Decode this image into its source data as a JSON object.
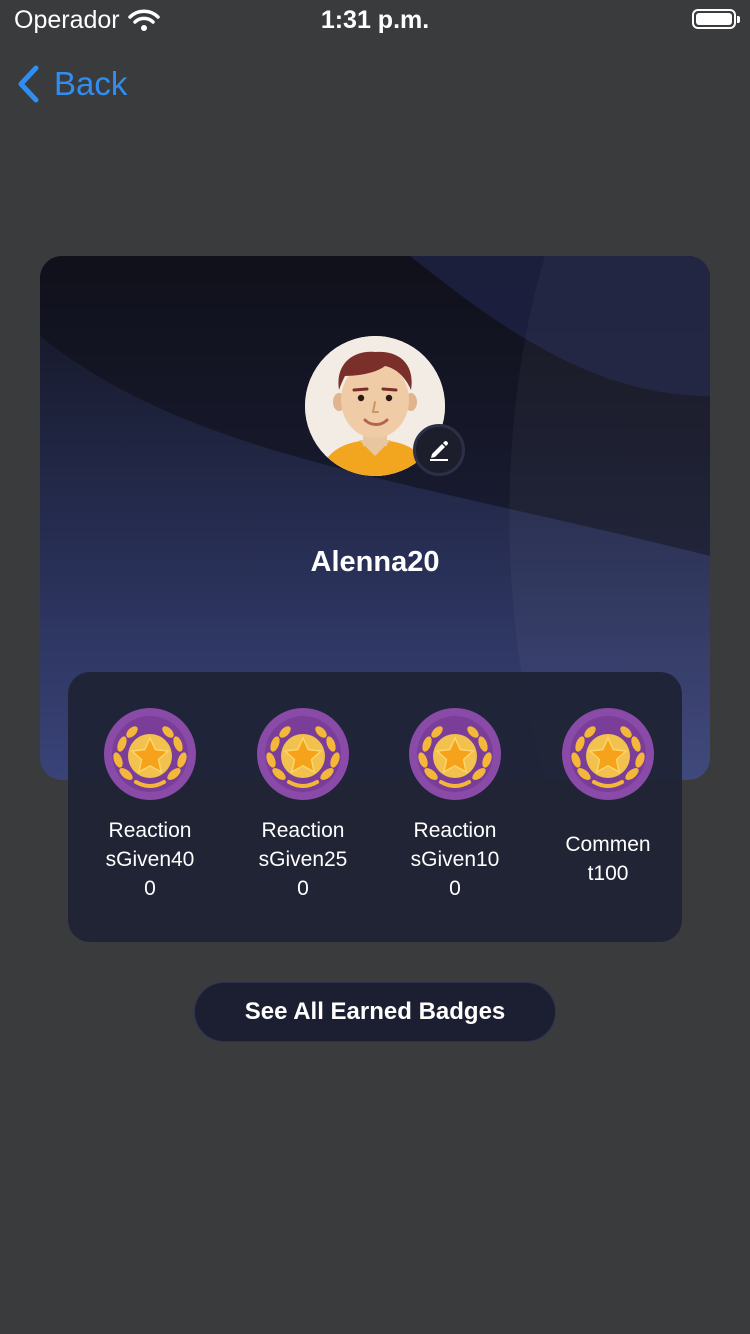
{
  "status_bar": {
    "carrier": "Operador",
    "time": "1:31 p.m."
  },
  "nav": {
    "back_label": "Back"
  },
  "profile": {
    "username": "Alenna20"
  },
  "badges": [
    {
      "label": "Reaction\nsGiven40\n0"
    },
    {
      "label": "Reaction\nsGiven25\n0"
    },
    {
      "label": "Reaction\nsGiven10\n0"
    },
    {
      "label": "Commen\nt100"
    }
  ],
  "actions": {
    "see_all_label": "See All Earned Badges"
  },
  "colors": {
    "background": "#3a3b3d",
    "accent": "#2f8ef2",
    "badge_purple": "#8a4aa8",
    "badge_gold": "#f5b73a"
  }
}
